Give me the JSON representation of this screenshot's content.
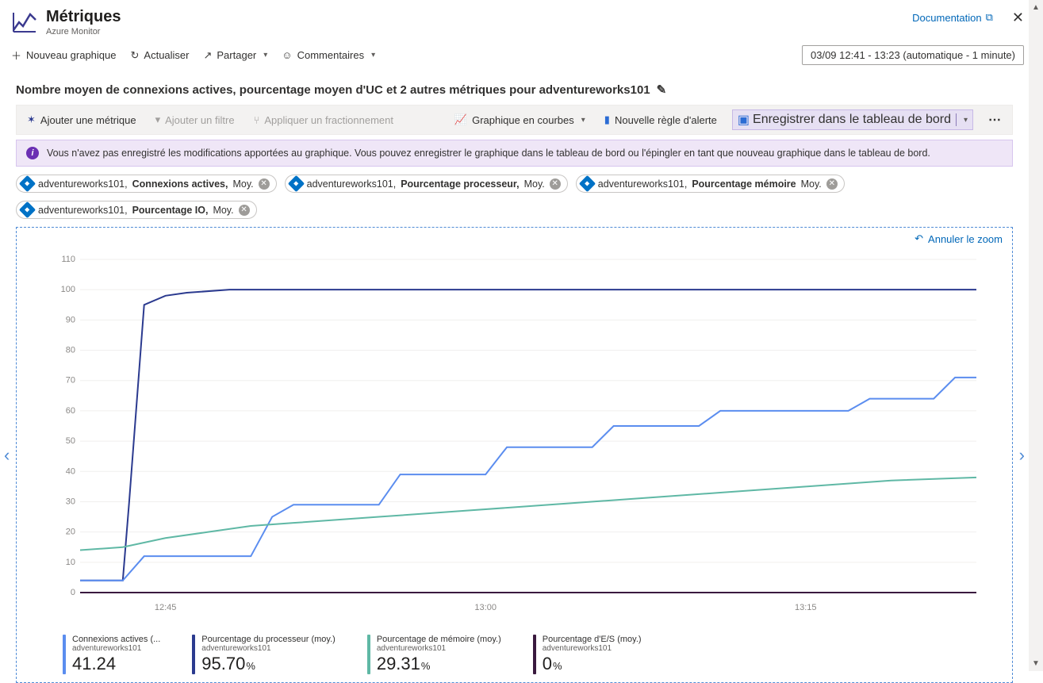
{
  "header": {
    "title": "Métriques",
    "subtitle": "Azure Monitor",
    "doc_link": "Documentation",
    "close": "✕"
  },
  "cmdbar": {
    "new_chart": "Nouveau graphique",
    "refresh": "Actualiser",
    "share": "Partager",
    "feedback": "Commentaires"
  },
  "time_range": "03/09 12:41 - 13:23 (automatique - 1 minute)",
  "chart_title": "Nombre moyen de connexions actives, pourcentage moyen d'UC et 2 autres métriques pour adventureworks101",
  "toolbar": {
    "add_metric": "Ajouter une métrique",
    "add_filter": "Ajouter un filtre",
    "apply_split": "Appliquer un fractionnement",
    "chart_type": "Graphique en courbes",
    "new_alert": "Nouvelle règle d'alerte",
    "pin": "Enregistrer dans le tableau de bord",
    "more": "⋯"
  },
  "info": "Vous n'avez pas enregistré les modifications apportées au graphique. Vous pouvez enregistrer le graphique dans le tableau de bord ou l'épingler en tant que nouveau graphique dans le tableau de bord.",
  "pills": [
    {
      "scope": "adventureworks101,",
      "metric": "Connexions actives,",
      "agg": "Moy."
    },
    {
      "scope": "adventureworks101,",
      "metric": "Pourcentage processeur,",
      "agg": "Moy."
    },
    {
      "scope": "adventureworks101,",
      "metric": "Pourcentage mémoire",
      "agg": "Moy."
    },
    {
      "scope": "adventureworks101,",
      "metric": "Pourcentage IO,",
      "agg": "Moy."
    }
  ],
  "undo_zoom": "Annuler le zoom",
  "legend": [
    {
      "label": "Connexions actives (...",
      "sub": "adventureworks101",
      "value": "41.24",
      "unit": ""
    },
    {
      "label": "Pourcentage du processeur (moy.)",
      "sub": "adventureworks101",
      "value": "95.70",
      "unit": "%"
    },
    {
      "label": "Pourcentage de mémoire (moy.)",
      "sub": "adventureworks101",
      "value": "29.31",
      "unit": "%"
    },
    {
      "label": "Pourcentage d'E/S (moy.)",
      "sub": "adventureworks101",
      "value": "0",
      "unit": "%"
    }
  ],
  "chart_data": {
    "type": "line",
    "title": "Nombre moyen de connexions actives, pourcentage moyen d'UC et 2 autres métriques pour adventureworks101",
    "xlabel": "",
    "ylabel": "",
    "ylim": [
      0,
      110
    ],
    "y_ticks": [
      0,
      10,
      20,
      30,
      40,
      50,
      60,
      70,
      80,
      90,
      100,
      110
    ],
    "x_ticks": [
      "12:45",
      "13:00",
      "13:15"
    ],
    "x_range_minutes": [
      0,
      42
    ],
    "series": [
      {
        "name": "Pourcentage du processeur (moy.)",
        "color": "#2b3a8f",
        "points": [
          [
            0,
            4
          ],
          [
            2,
            4
          ],
          [
            2.3,
            30
          ],
          [
            3,
            95
          ],
          [
            4,
            98
          ],
          [
            5,
            99
          ],
          [
            7,
            100
          ],
          [
            12,
            100
          ],
          [
            20,
            100
          ],
          [
            30,
            100
          ],
          [
            42,
            100
          ]
        ]
      },
      {
        "name": "Connexions actives (moy.)",
        "color": "#5b8def",
        "points": [
          [
            0,
            4
          ],
          [
            2,
            4
          ],
          [
            3,
            12
          ],
          [
            7,
            12
          ],
          [
            8,
            12
          ],
          [
            9,
            25
          ],
          [
            10,
            29
          ],
          [
            14,
            29
          ],
          [
            15,
            39
          ],
          [
            19,
            39
          ],
          [
            20,
            48
          ],
          [
            24,
            48
          ],
          [
            25,
            55
          ],
          [
            29,
            55
          ],
          [
            30,
            60
          ],
          [
            36,
            60
          ],
          [
            37,
            64
          ],
          [
            40,
            64
          ],
          [
            41,
            71
          ],
          [
            42,
            71
          ]
        ]
      },
      {
        "name": "Pourcentage de mémoire (moy.)",
        "color": "#5fb8a5",
        "points": [
          [
            0,
            14
          ],
          [
            2,
            15
          ],
          [
            4,
            18
          ],
          [
            6,
            20
          ],
          [
            8,
            22
          ],
          [
            10,
            23
          ],
          [
            14,
            25
          ],
          [
            18,
            27
          ],
          [
            22,
            29
          ],
          [
            26,
            31
          ],
          [
            30,
            33
          ],
          [
            34,
            35
          ],
          [
            38,
            37
          ],
          [
            42,
            38
          ]
        ]
      },
      {
        "name": "Pourcentage d'E/S (moy.)",
        "color": "#3a1a3f",
        "points": [
          [
            0,
            0
          ],
          [
            42,
            0
          ]
        ]
      }
    ]
  }
}
